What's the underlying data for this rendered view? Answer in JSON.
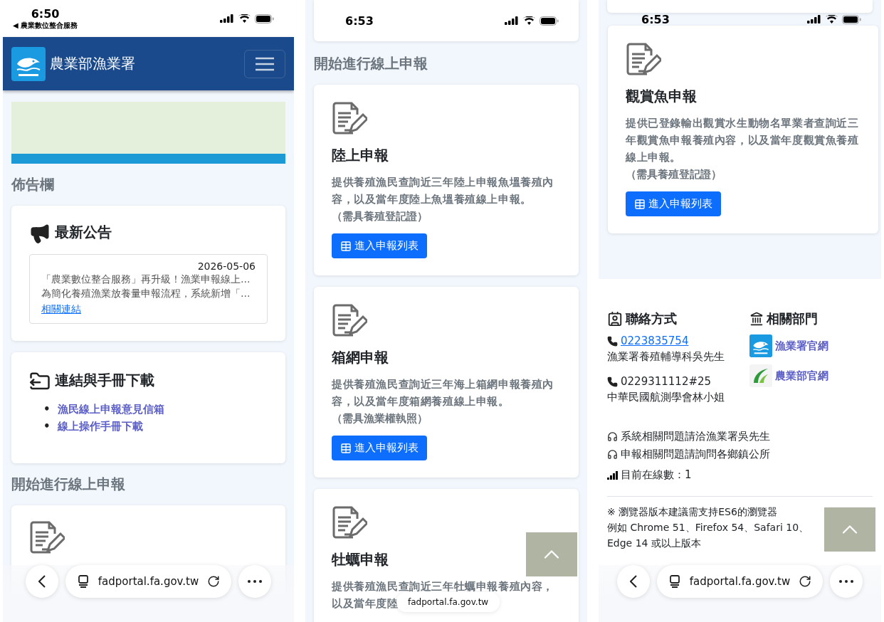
{
  "left_screen": {
    "status_bar": {
      "time": "6:50",
      "back_label": "◀ 農業數位整合服務"
    },
    "navbar": {
      "title": "農業部漁業署"
    },
    "bulletin_title": "佈告欄",
    "news_card": {
      "title": "最新公告",
      "date": "2026-05-06",
      "lines": [
        "「農業數位整合服務」再升級！漁業申報線上…",
        "為簡化養殖漁業放養量申報流程，系統新增「…"
      ],
      "link": "相關連結"
    },
    "links_card": {
      "title": "連結與手冊下載",
      "links": [
        {
          "marker": "•",
          "label": "漁民線上申報意見信箱"
        },
        {
          "marker": "•",
          "label": "線上操作手冊下載"
        }
      ]
    },
    "report_title": "開始進行線上申報",
    "browser_bar": {
      "url": "fadportal.fa.gov.tw"
    }
  },
  "middle_screen": {
    "status_bar": {
      "time": "6:53"
    },
    "report_title": "開始進行線上申報",
    "cards": [
      {
        "title": "陸上申報",
        "description": "提供養殖漁民查詢近三年陸上申報魚塭養殖內容，以及當年度陸上魚塭養殖線上申報。",
        "requirement": "（需具養殖登記證）",
        "button": "進入申報列表"
      },
      {
        "title": "箱網申報",
        "description": "提供養殖漁民查詢近三年海上箱網申報養殖內容，以及當年度箱網養殖線上申報。",
        "requirement": "（需具漁業權執照）",
        "button": "進入申報列表"
      },
      {
        "title": "牡蠣申報",
        "description_lines": [
          "提供養殖漁民查詢近三年牡蠣申報養殖內容，",
          "以及當年度陸"
        ]
      }
    ],
    "url_pill": "fadportal.fa.gov.tw"
  },
  "right_screen": {
    "status_bar": {
      "time": "6:53"
    },
    "card": {
      "title": "觀賞魚申報",
      "description": "提供已登錄輸出觀賞水生動物名單業者查詢近三年觀賞魚申報養殖內容，以及當年度觀賞魚養殖線上申報。",
      "requirement": "（需具養殖登記證）",
      "button": "進入申報列表"
    },
    "contact": {
      "title": "聯絡方式",
      "entries": [
        {
          "phone": "0223835754",
          "link": true,
          "person": "漁業署養殖輔導科吳先生"
        },
        {
          "phone": "0229311112#25",
          "link": false,
          "person": "中華民國航測學會林小姐"
        }
      ]
    },
    "departments": {
      "title": "相關部門",
      "links": [
        {
          "kind": "fa",
          "name": "漁業署官網"
        },
        {
          "kind": "moa",
          "name": "農業部官網"
        }
      ]
    },
    "support": [
      "系統相關問題請洽漁業署吳先生",
      "申報相關問題請詢問各鄉鎮公所"
    ],
    "online": "目前在線數：1",
    "notes": [
      "※ 瀏覽器版本建議需支持ES6的瀏覽器",
      "例如 Chrome 51、Firefox 54、Safari 10、Edge 14 或以上版本"
    ],
    "browser_bar": {
      "url": "fadportal.fa.gov.tw"
    }
  }
}
